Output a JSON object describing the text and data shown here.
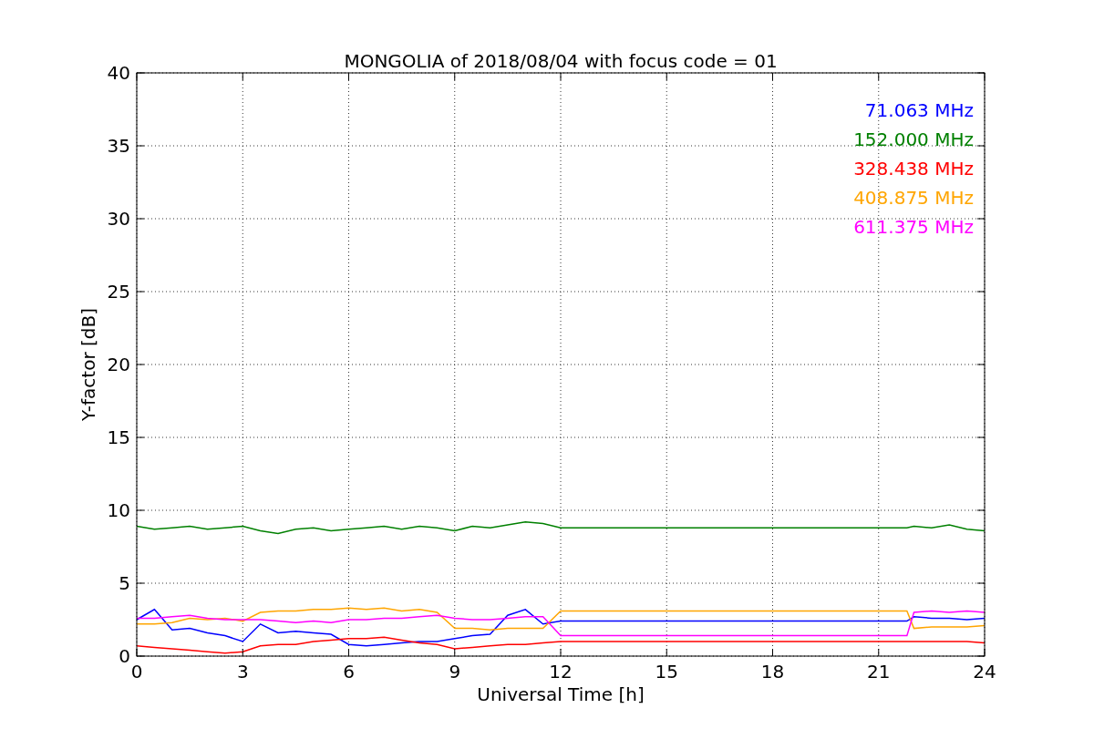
{
  "chart_data": {
    "type": "line",
    "title": "MONGOLIA of 2018/08/04 with focus code = 01",
    "xlabel": "Universal Time [h]",
    "ylabel": "Y-factor [dB]",
    "xlim": [
      0,
      24
    ],
    "ylim": [
      0,
      40
    ],
    "xticks": [
      0,
      3,
      6,
      9,
      12,
      15,
      18,
      21,
      24
    ],
    "yticks": [
      0,
      5,
      10,
      15,
      20,
      25,
      30,
      35,
      40
    ],
    "grid": true,
    "x": [
      0,
      0.5,
      1,
      1.5,
      2,
      2.5,
      3,
      3.5,
      4,
      4.5,
      5,
      5.5,
      6,
      6.5,
      7,
      7.5,
      8,
      8.5,
      9,
      9.5,
      10,
      10.5,
      11,
      11.5,
      12,
      21.8,
      22,
      22.5,
      23,
      23.5,
      24
    ],
    "series": [
      {
        "name": "71.063 MHz",
        "color": "#0000ff",
        "values": [
          2.5,
          3.2,
          1.8,
          1.9,
          1.6,
          1.4,
          1.0,
          2.2,
          1.6,
          1.7,
          1.6,
          1.5,
          0.8,
          0.7,
          0.8,
          0.9,
          1.0,
          1.0,
          1.2,
          1.4,
          1.5,
          2.8,
          3.2,
          2.2,
          2.4,
          2.4,
          2.7,
          2.6,
          2.6,
          2.5,
          2.6
        ]
      },
      {
        "name": "152.000 MHz",
        "color": "#008000",
        "values": [
          8.9,
          8.7,
          8.8,
          8.9,
          8.7,
          8.8,
          8.9,
          8.6,
          8.4,
          8.7,
          8.8,
          8.6,
          8.7,
          8.8,
          8.9,
          8.7,
          8.9,
          8.8,
          8.6,
          8.9,
          8.8,
          9.0,
          9.2,
          9.1,
          8.8,
          8.8,
          8.9,
          8.8,
          9.0,
          8.7,
          8.6
        ]
      },
      {
        "name": "328.438 MHz",
        "color": "#ff0000",
        "values": [
          0.7,
          0.6,
          0.5,
          0.4,
          0.3,
          0.2,
          0.3,
          0.7,
          0.8,
          0.8,
          1.0,
          1.1,
          1.2,
          1.2,
          1.3,
          1.1,
          0.9,
          0.8,
          0.5,
          0.6,
          0.7,
          0.8,
          0.8,
          0.9,
          1.0,
          1.0,
          1.0,
          1.0,
          1.0,
          1.0,
          0.9
        ]
      },
      {
        "name": "408.875 MHz",
        "color": "#ffa500",
        "values": [
          2.2,
          2.2,
          2.3,
          2.6,
          2.5,
          2.6,
          2.4,
          3.0,
          3.1,
          3.1,
          3.2,
          3.2,
          3.3,
          3.2,
          3.3,
          3.1,
          3.2,
          3.0,
          1.9,
          1.9,
          1.8,
          1.9,
          1.9,
          1.9,
          3.1,
          3.1,
          1.9,
          2.0,
          2.0,
          2.0,
          2.1
        ]
      },
      {
        "name": "611.375 MHz",
        "color": "#ff00ff",
        "values": [
          2.6,
          2.6,
          2.7,
          2.8,
          2.6,
          2.5,
          2.5,
          2.5,
          2.4,
          2.3,
          2.4,
          2.3,
          2.5,
          2.5,
          2.6,
          2.6,
          2.7,
          2.8,
          2.6,
          2.5,
          2.5,
          2.6,
          2.7,
          2.7,
          1.4,
          1.4,
          3.0,
          3.1,
          3.0,
          3.1,
          3.0
        ]
      }
    ]
  }
}
